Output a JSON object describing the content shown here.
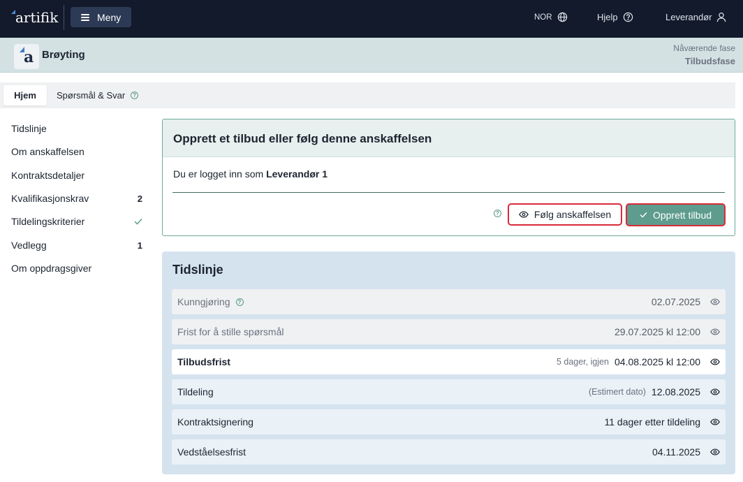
{
  "topbar": {
    "logo": "artifik",
    "menu_label": "Meny",
    "language": "NOR",
    "help": "Hjelp",
    "user": "Leverandør"
  },
  "procurement": {
    "title": "Brøyting",
    "phase_label": "Nåværende fase",
    "phase_value": "Tilbudsfase"
  },
  "tabs": [
    {
      "label": "Hjem",
      "active": true
    },
    {
      "label": "Spørsmål & Svar",
      "active": false
    }
  ],
  "sidenav": [
    {
      "label": "Tidslinje",
      "badge": ""
    },
    {
      "label": "Om anskaffelsen",
      "badge": ""
    },
    {
      "label": "Kontraktsdetaljer",
      "badge": ""
    },
    {
      "label": "Kvalifikasjonskrav",
      "badge": "2"
    },
    {
      "label": "Tildelingskriterier",
      "badge": "check"
    },
    {
      "label": "Vedlegg",
      "badge": "1"
    },
    {
      "label": "Om oppdragsgiver",
      "badge": ""
    }
  ],
  "card": {
    "title": "Opprett et tilbud eller følg denne anskaffelsen",
    "logged_in_prefix": "Du er logget inn som",
    "logged_in_user": "Leverandør 1",
    "follow_label": "Følg anskaffelsen",
    "create_label": "Opprett tilbud"
  },
  "timeline": {
    "title": "Tidslinje",
    "rows": [
      {
        "label": "Kunngjøring",
        "note": "",
        "date": "02.07.2025",
        "state": "past",
        "help": true
      },
      {
        "label": "Frist for å stille spørsmål",
        "note": "",
        "date": "29.07.2025 kl 12:00",
        "state": "past",
        "help": false
      },
      {
        "label": "Tilbudsfrist",
        "note": "5 dager, igjen",
        "date": "04.08.2025 kl 12:00",
        "state": "current",
        "help": false
      },
      {
        "label": "Tildeling",
        "note": "(Estimert dato)",
        "date": "12.08.2025",
        "state": "future",
        "help": false
      },
      {
        "label": "Kontraktsignering",
        "note": "",
        "date": "11 dager etter tildeling",
        "state": "future",
        "help": false
      },
      {
        "label": "Vedståelsesfrist",
        "note": "",
        "date": "04.11.2025",
        "state": "future",
        "help": false
      }
    ]
  },
  "colors": {
    "topbar": "#121a2b",
    "accent_green": "#5e9c8d",
    "highlight_red": "#d92a3a",
    "timeline_bg": "#d5e3ef"
  }
}
